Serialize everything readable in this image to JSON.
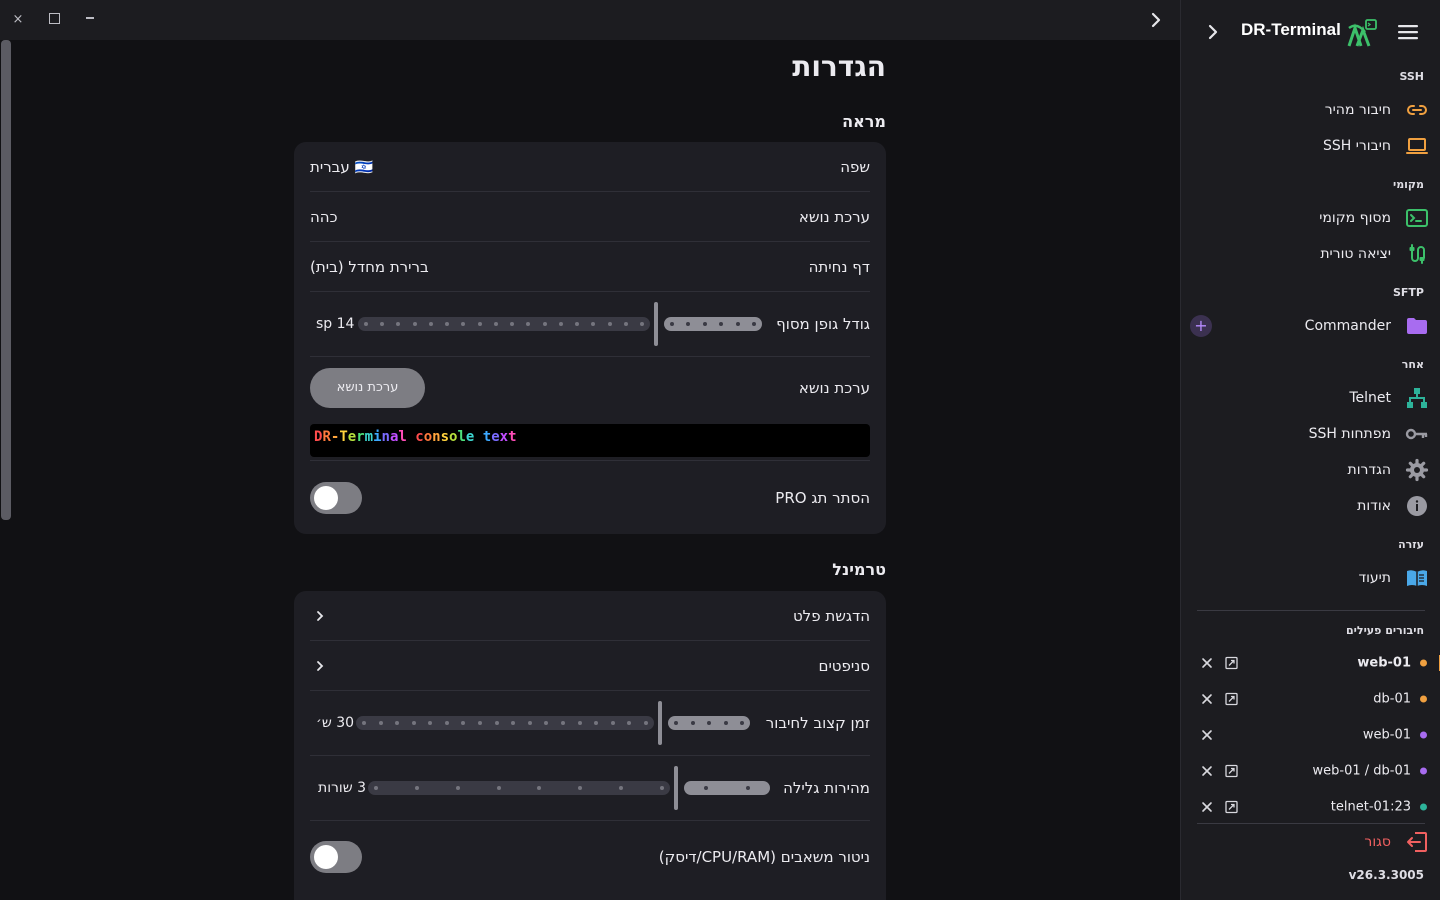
{
  "window": {
    "close_glyph": "×"
  },
  "page": {
    "title": "הגדרות"
  },
  "appearance": {
    "section_title": "מראה",
    "language_label": "שפה",
    "language_value": "🇮🇱 עברית",
    "theme_label": "ערכת נושא",
    "theme_value": "כהה",
    "landing_label": "דף נחיתה",
    "landing_value": "ברירת מחדל (בית)",
    "font_size_label": "גודל גופן מסוף",
    "font_size_value": "14 sp",
    "font_size_fraction": 0.18,
    "theme_picker_label": "ערכת נושא",
    "theme_picker_button": "ערכת נושא",
    "console_preview": "DR-Terminal console text",
    "hide_pro_label": "הסתר תג PRO",
    "hide_pro_on": false
  },
  "terminal": {
    "section_title": "טרמינל",
    "flat_label": "הדגשת פלט",
    "snippets_label": "סניפטים",
    "timeout_label": "זמן קצוב לחיבור",
    "timeout_value": "30 ש׳",
    "timeout_fraction": 0.17,
    "scroll_label": "מהירות גלילה",
    "scroll_value": "3 שורות",
    "scroll_fraction": 0.22,
    "monitor_label": "ניטור משאבים (CPU/RAM/דיסק)",
    "monitor_on": false
  },
  "sidebar": {
    "app_name": "DR-Terminal",
    "groups": {
      "ssh": "SSH",
      "local": "מקומי",
      "sftp": "SFTP",
      "other": "אחר",
      "help": "עזרה",
      "active": "חיבורים פעילים"
    },
    "items": {
      "quick_connect": "חיבור מהיר",
      "ssh_connections": "חיבורי SSH",
      "local_terminal": "מסוף מקומי",
      "serial": "יציאה טורית",
      "commander": "Commander",
      "telnet": "Telnet",
      "ssh_keys": "מפתחות SSH",
      "settings": "הגדרות",
      "about": "אודות",
      "docs": "תיעוד",
      "exit": "סגור"
    },
    "connections": [
      {
        "name": "web-01",
        "color": "#f0a040",
        "active": true
      },
      {
        "name": "db-01",
        "color": "#f0a040",
        "active": false
      },
      {
        "name": "web-01",
        "color": "#a86cf0",
        "active": false
      },
      {
        "name": "web-01 / db-01",
        "color": "#a86cf0",
        "active": false
      },
      {
        "name": "telnet-01:23",
        "color": "#2db39a",
        "active": false
      }
    ],
    "version": "v26.3.3005"
  },
  "colors": {
    "accent_orange": "#f0a040",
    "accent_green": "#3cc06a",
    "accent_purple": "#a86cf0",
    "accent_teal": "#2db39a",
    "exit_red": "#f06060"
  }
}
